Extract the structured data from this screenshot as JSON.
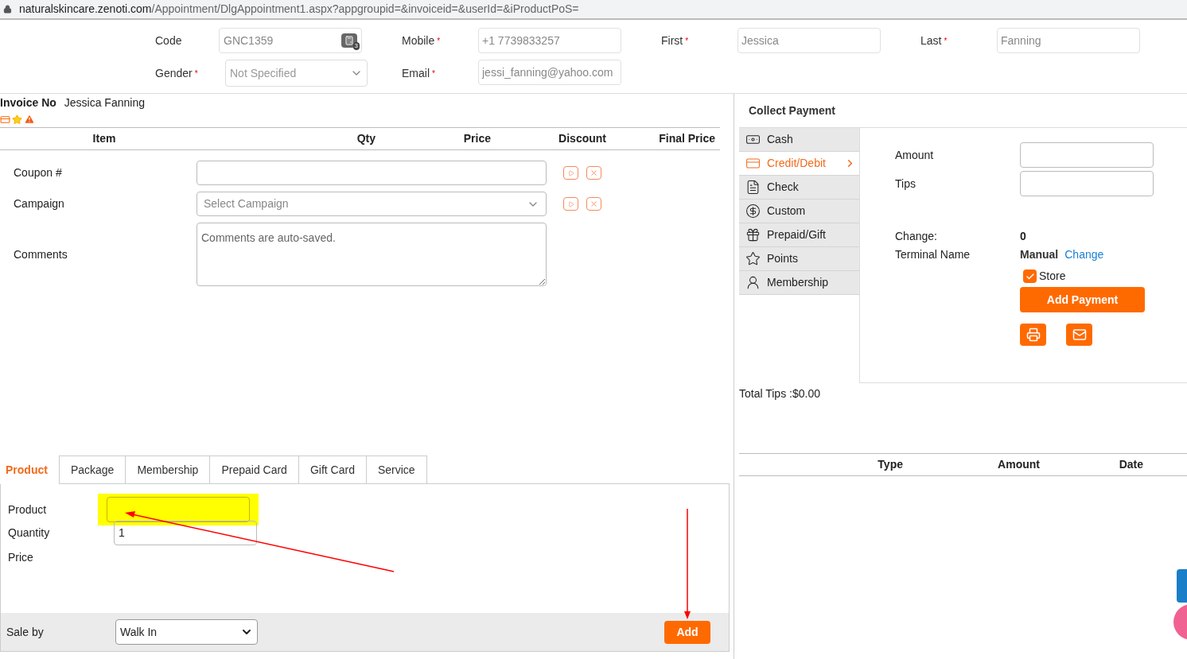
{
  "address_bar": {
    "host": "naturalskincare.zenoti.com",
    "path": "/Appointment/DlgAppointment1.aspx?appgroupid=&invoiceid=&userId=&iProductPoS="
  },
  "header_rows": [
    [
      {
        "label": "Code",
        "kind": "code",
        "value": "GNC1359",
        "badge": "3"
      },
      {
        "label": "Mobile",
        "required_mark": "*",
        "kind": "input",
        "value": "+1 7739833257"
      },
      {
        "label": "First",
        "required_mark": "*",
        "kind": "input",
        "value": "Jessica"
      },
      {
        "label": "Last",
        "required_mark": "*",
        "kind": "input",
        "value": "Fanning"
      }
    ],
    [
      {
        "label": "Gender",
        "required_mark": "*",
        "kind": "select",
        "value": "Not Specified"
      },
      {
        "label": "Email",
        "required_mark": "*",
        "kind": "input",
        "value": "jessi_fanning@yahoo.com"
      }
    ]
  ],
  "invoice": {
    "label": "Invoice No",
    "name": "Jessica Fanning"
  },
  "items_table": {
    "columns": [
      "Item",
      "Qty",
      "Price",
      "Discount",
      "Final Price"
    ]
  },
  "discount_rows": [
    {
      "kind": "input",
      "label": "Coupon #",
      "placeholder": ""
    },
    {
      "kind": "select",
      "label": "Campaign",
      "placeholder": "Select Campaign"
    },
    {
      "kind": "textarea",
      "label": "Comments",
      "placeholder": "Comments are auto-saved."
    }
  ],
  "tabs": [
    {
      "label": "Product",
      "selected": true
    },
    {
      "label": "Package",
      "selected": false
    },
    {
      "label": "Membership",
      "selected": false
    },
    {
      "label": "Prepaid Card",
      "selected": false
    },
    {
      "label": "Gift Card",
      "selected": false
    },
    {
      "label": "Service",
      "selected": false
    }
  ],
  "product_form": {
    "product_label": "Product",
    "quantity_label": "Quantity",
    "quantity": "1",
    "price_label": "Price",
    "sale_by_label": "Sale by",
    "sale_by": "Walk In",
    "add_button": "Add"
  },
  "payment": {
    "title": "Collect Payment",
    "methods": [
      {
        "label": "Cash",
        "kind": "cash",
        "selected": false
      },
      {
        "label": "Credit/Debit",
        "kind": "card",
        "selected": true
      },
      {
        "label": "Check",
        "kind": "check",
        "selected": false
      },
      {
        "label": "Custom",
        "kind": "custom",
        "selected": false
      },
      {
        "label": "Prepaid/Gift",
        "kind": "gift",
        "selected": false
      },
      {
        "label": "Points",
        "kind": "points",
        "selected": false
      },
      {
        "label": "Membership",
        "kind": "membership",
        "selected": false
      }
    ],
    "amount_label": "Amount",
    "tips_label": "Tips",
    "change_label": "Change:",
    "change_value": "0",
    "terminal_label": "Terminal Name",
    "terminal_value": "Manual",
    "terminal_link": "Change",
    "store": {
      "label": "Store",
      "checked": true
    },
    "add_payment": "Add Payment",
    "total_tips": "Total Tips :$0.00"
  },
  "payments_table": {
    "columns": [
      "Type",
      "Amount",
      "Date"
    ]
  }
}
